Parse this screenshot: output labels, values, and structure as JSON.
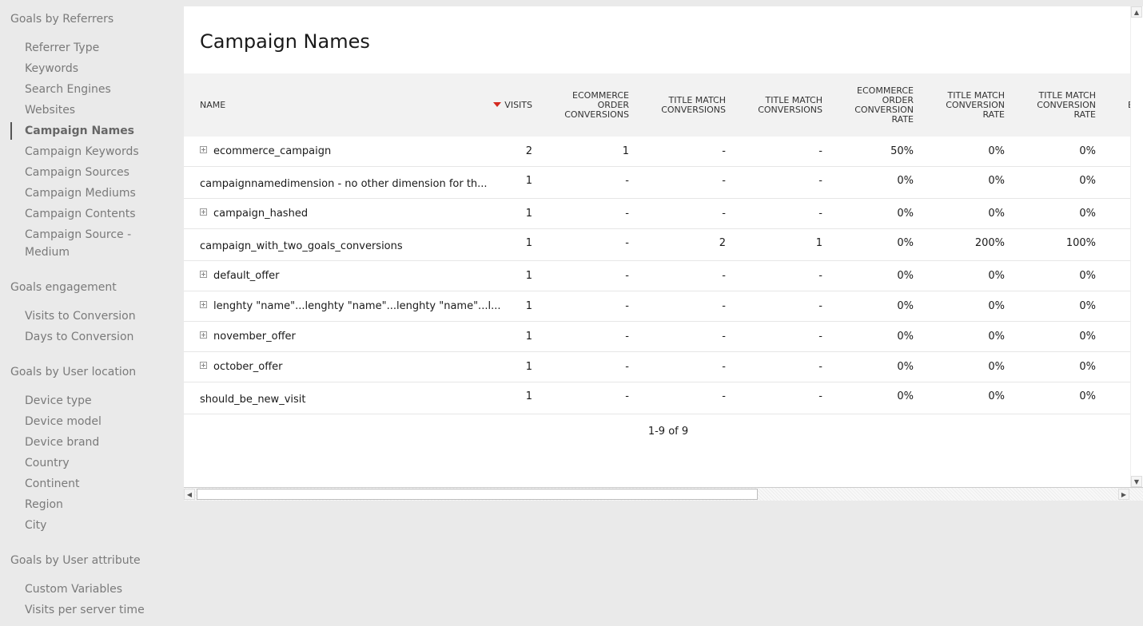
{
  "sidebar": {
    "groups": [
      {
        "title": "Goals by Referrers",
        "items": [
          "Referrer Type",
          "Keywords",
          "Search Engines",
          "Websites",
          "Campaign Names",
          "Campaign Keywords",
          "Campaign Sources",
          "Campaign Mediums",
          "Campaign Contents",
          "Campaign Source - Medium"
        ]
      },
      {
        "title": "Goals engagement",
        "items": [
          "Visits to Conversion",
          "Days to Conversion"
        ]
      },
      {
        "title": "Goals by User location",
        "items": [
          "Device type",
          "Device model",
          "Device brand",
          "Country",
          "Continent",
          "Region",
          "City"
        ]
      },
      {
        "title": "Goals by User attribute",
        "items": [
          "Custom Variables",
          "Visits per server time"
        ]
      }
    ],
    "active_item": "Campaign Names"
  },
  "report": {
    "title": "Campaign Names",
    "columns": [
      "NAME",
      "VISITS",
      "ECOMMERCE ORDER CONVERSIONS",
      "TITLE MATCH CONVERSIONS",
      "TITLE MATCH CONVERSIONS",
      "ECOMMERCE ORDER CONVERSION RATE",
      "TITLE MATCH CONVERSION RATE",
      "TITLE MATCH CONVERSION RATE",
      "E"
    ],
    "rows": [
      {
        "name": "ecommerce_campaign",
        "expandable": true,
        "values": [
          "2",
          "1",
          "-",
          "-",
          "50%",
          "0%",
          "0%"
        ]
      },
      {
        "name": "campaignnamedimension - no other dimension for th...",
        "expandable": false,
        "values": [
          "1",
          "-",
          "-",
          "-",
          "0%",
          "0%",
          "0%"
        ]
      },
      {
        "name": "campaign_hashed",
        "expandable": true,
        "values": [
          "1",
          "-",
          "-",
          "-",
          "0%",
          "0%",
          "0%"
        ]
      },
      {
        "name": "campaign_with_two_goals_conversions",
        "expandable": false,
        "values": [
          "1",
          "-",
          "2",
          "1",
          "0%",
          "200%",
          "100%"
        ]
      },
      {
        "name": "default_offer",
        "expandable": true,
        "values": [
          "1",
          "-",
          "-",
          "-",
          "0%",
          "0%",
          "0%"
        ]
      },
      {
        "name": "lenghty \"name\"...lenghty \"name\"...lenghty \"name\"...l...",
        "expandable": true,
        "values": [
          "1",
          "-",
          "-",
          "-",
          "0%",
          "0%",
          "0%"
        ]
      },
      {
        "name": "november_offer",
        "expandable": true,
        "values": [
          "1",
          "-",
          "-",
          "-",
          "0%",
          "0%",
          "0%"
        ]
      },
      {
        "name": "october_offer",
        "expandable": true,
        "values": [
          "1",
          "-",
          "-",
          "-",
          "0%",
          "0%",
          "0%"
        ]
      },
      {
        "name": "should_be_new_visit",
        "expandable": false,
        "values": [
          "1",
          "-",
          "-",
          "-",
          "0%",
          "0%",
          "0%"
        ]
      }
    ],
    "pagination": "1-9 of 9"
  },
  "icons": {
    "sort": "sort-desc-icon",
    "expand": "plus-square-icon",
    "scroll_up": "arrow-up-icon",
    "scroll_down": "arrow-down-icon",
    "scroll_left": "arrow-left-icon",
    "scroll_right": "arrow-right-icon"
  },
  "colors": {
    "sort_arrow": "#d4291f",
    "header_bg": "#f2f2f2",
    "page_bg": "#eaeaea"
  }
}
